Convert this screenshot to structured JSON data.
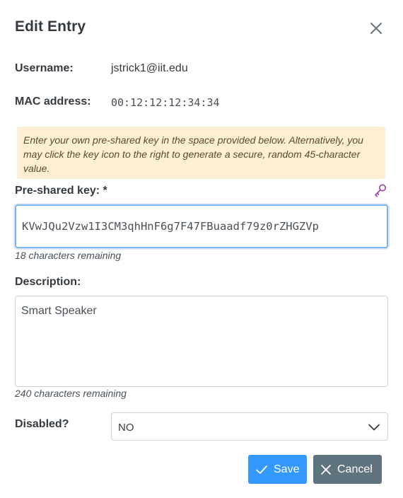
{
  "dialog": {
    "title": "Edit Entry",
    "close_icon": "close-icon"
  },
  "username": {
    "label": "Username:",
    "value": "jstrick1@iit.edu"
  },
  "mac": {
    "label": "MAC address:",
    "value": "00:12:12:12:34:34"
  },
  "hint": {
    "text": "Enter your own pre-shared key in the space provided below. Alternatively, you may click the key icon to the right to generate a secure, random 45-character value."
  },
  "psk": {
    "label": "Pre-shared key: *",
    "value": "KVwJQu2Vzw1I3CM3qhHnF6g7F47FBuaadf79z0rZHGZVp",
    "remaining": "18 characters remaining",
    "generate_icon": "key-icon"
  },
  "description": {
    "label": "Description:",
    "value": "Smart Speaker",
    "remaining": "240 characters remaining"
  },
  "disabled": {
    "label": "Disabled?",
    "selected": "NO"
  },
  "actions": {
    "save_label": "Save",
    "cancel_label": "Cancel"
  },
  "colors": {
    "save": "#3399ff",
    "cancel": "#607480",
    "hint_bg": "#fcefd4",
    "key_icon": "#9b3fb0",
    "focus_border": "#7cb2ef"
  }
}
